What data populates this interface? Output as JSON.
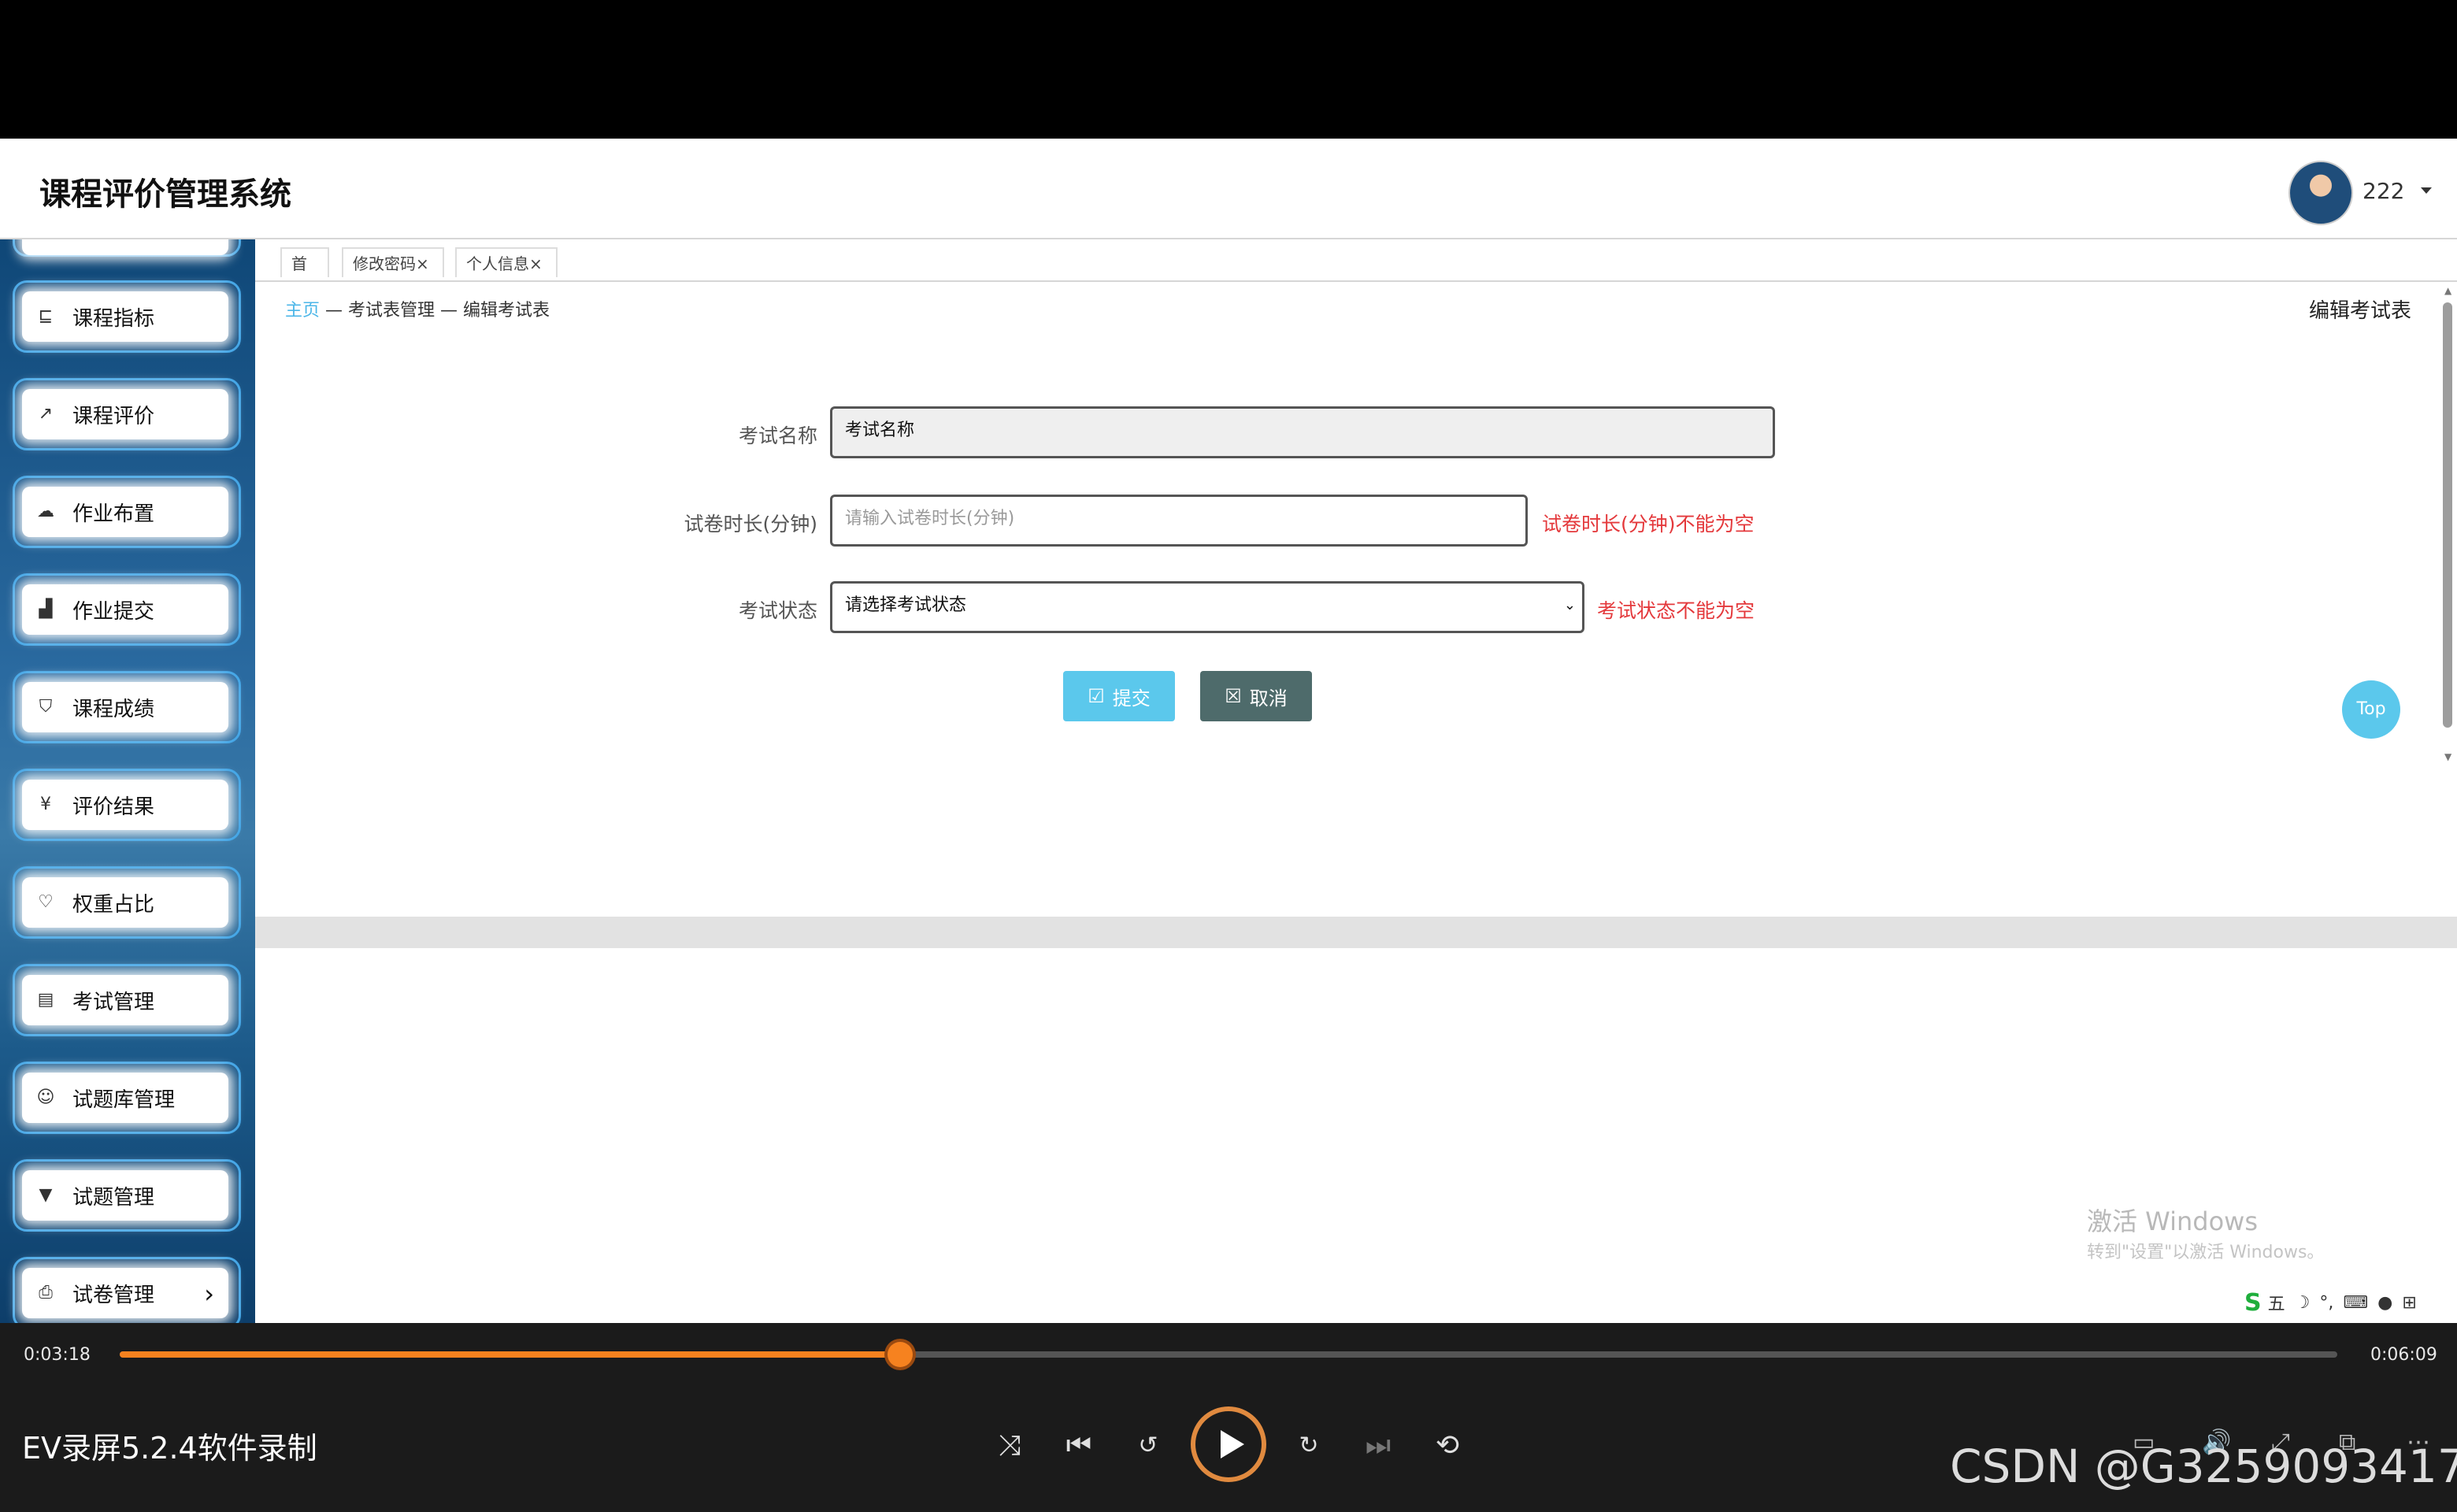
{
  "app": {
    "title": "课程评价管理系统",
    "username": "222"
  },
  "sidebar": {
    "items": [
      {
        "label": "课程指标",
        "icon": "list-icon"
      },
      {
        "label": "课程评价",
        "icon": "share-icon"
      },
      {
        "label": "作业布置",
        "icon": "cloud-icon"
      },
      {
        "label": "作业提交",
        "icon": "bar-chart-icon"
      },
      {
        "label": "课程成绩",
        "icon": "shield-icon"
      },
      {
        "label": "评价结果",
        "icon": "yen-icon"
      },
      {
        "label": "权重占比",
        "icon": "heart-icon"
      },
      {
        "label": "考试管理",
        "icon": "document-icon"
      },
      {
        "label": "试题库管理",
        "icon": "smile-icon"
      },
      {
        "label": "试题管理",
        "icon": "triangle-down-icon"
      },
      {
        "label": "试卷管理",
        "icon": "printer-icon"
      }
    ]
  },
  "tabs": [
    {
      "label": "首页",
      "closable": false
    },
    {
      "label": "修改密码",
      "closable": true
    },
    {
      "label": "个人信息",
      "closable": true
    }
  ],
  "breadcrumb": {
    "home": "主页",
    "sep": " — ",
    "level1": "考试表管理",
    "level2": "编辑考试表"
  },
  "page_title": "编辑考试表",
  "form": {
    "name_label": "考试名称",
    "name_value": "考试名称",
    "duration_label": "试卷时长(分钟)",
    "duration_placeholder": "请输入试卷时长(分钟)",
    "duration_error": "试卷时长(分钟)不能为空",
    "status_label": "考试状态",
    "status_selected": "请选择考试状态",
    "status_error": "考试状态不能为空",
    "submit_label": "提交",
    "cancel_label": "取消"
  },
  "top_button": "Top",
  "watermark": {
    "line1": "激活 Windows",
    "line2": "转到\"设置\"以激活 Windows。"
  },
  "ime": {
    "label": "五"
  },
  "player": {
    "current_time": "0:03:18",
    "total_time": "0:06:09",
    "progress": 0.352,
    "recorder_label": "EV录屏5.2.4软件录制"
  },
  "credit": "CSDN @G3259093417",
  "colors": {
    "accent": "#f6821f",
    "link": "#4bb6e8",
    "error": "#e4393c",
    "submit": "#5bc8ec",
    "cancel": "#4e6b6b"
  }
}
